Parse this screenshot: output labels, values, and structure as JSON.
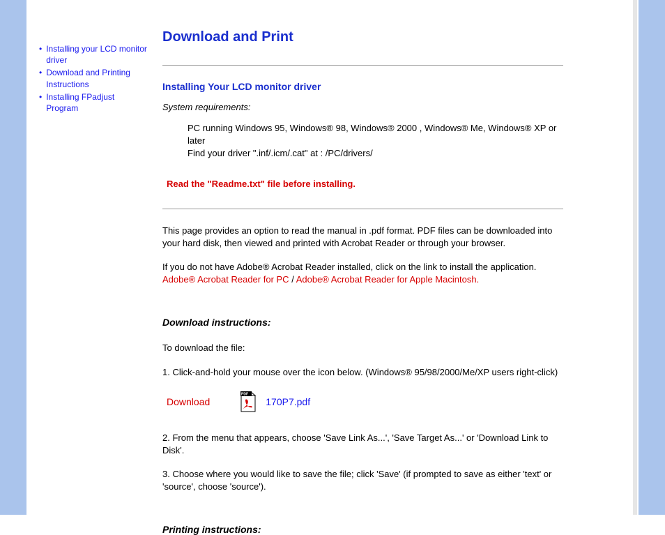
{
  "sidebar": {
    "items": [
      {
        "label": "Installing your LCD monitor driver"
      },
      {
        "label": "Download and Printing Instructions"
      },
      {
        "label": "Installing FPadjust Program"
      }
    ]
  },
  "main": {
    "title": "Download and Print",
    "section1": {
      "heading": "Installing Your LCD monitor driver",
      "sys_req_label": "System requirements:",
      "req1": "PC running Windows 95, Windows® 98, Windows® 2000 , Windows® Me, Windows® XP or later",
      "req2": "Find your driver \".inf/.icm/.cat\" at : /PC/drivers/",
      "warning": "Read the \"Readme.txt\" file before installing."
    },
    "section2": {
      "p1": "This page provides an option to read the manual in .pdf format. PDF files can be downloaded into your hard disk, then viewed and printed with Acrobat Reader or through your browser.",
      "p2a": "If you do not have Adobe® Acrobat Reader installed, click on the link to install the application.",
      "link_pc": "Adobe® Acrobat Reader for PC",
      "sep": " / ",
      "link_mac": "Adobe® Acrobat Reader for Apple Macintosh."
    },
    "download": {
      "heading": "Download instructions:",
      "intro": "To download the file:",
      "step1": "1. Click-and-hold your mouse over the icon below. (Windows® 95/98/2000/Me/XP users right-click)",
      "label": "Download",
      "file": "170P7.pdf",
      "step2": "2. From the menu that appears, choose 'Save Link As...', 'Save Target As...' or 'Download Link to Disk'.",
      "step3": "3. Choose where you would like to save the file; click 'Save' (if prompted to save as either 'text' or 'source', choose 'source')."
    },
    "printing": {
      "heading": "Printing instructions:"
    }
  }
}
